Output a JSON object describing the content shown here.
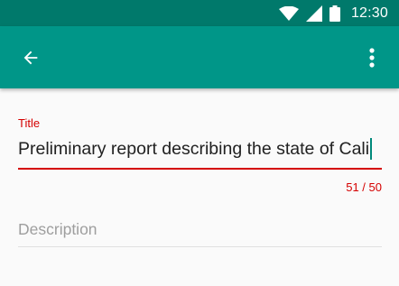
{
  "status_bar": {
    "time": "12:30",
    "icons": [
      "wifi-icon",
      "signal-icon",
      "battery-icon"
    ],
    "color": "#00796b"
  },
  "app_bar": {
    "color": "#009688",
    "back_icon": "arrow-back-icon",
    "menu_icon": "more-vert-icon"
  },
  "form": {
    "title_label": "Title",
    "title_value": "Preliminary report describing the state of Cali",
    "char_counter": "51 / 50",
    "error_color": "#d50000",
    "description_placeholder": "Description",
    "description_value": ""
  }
}
